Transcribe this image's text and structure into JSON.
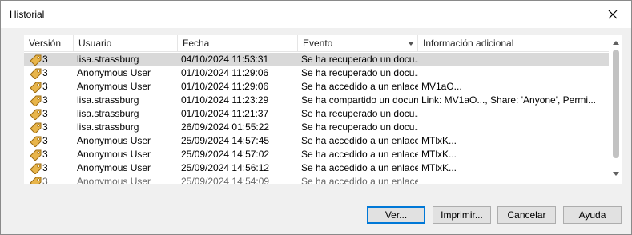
{
  "window": {
    "title": "Historial"
  },
  "columns": [
    "Versión",
    "Usuario",
    "Fecha",
    "Evento",
    "Información adicional"
  ],
  "rows": [
    {
      "version": "3",
      "user": "lisa.strassburg",
      "date": "04/10/2024 11:53:31",
      "event": "Se ha recuperado un docu...",
      "info": "",
      "selected": true
    },
    {
      "version": "3",
      "user": "Anonymous User",
      "date": "01/10/2024 11:29:06",
      "event": "Se ha recuperado un docu...",
      "info": ""
    },
    {
      "version": "3",
      "user": "Anonymous User",
      "date": "01/10/2024 11:29:06",
      "event": "Se ha accedido a un enlace...",
      "info": "MV1aO..."
    },
    {
      "version": "3",
      "user": "lisa.strassburg",
      "date": "01/10/2024 11:23:29",
      "event": "Se ha compartido un docum...",
      "info": "Link: MV1aO..., Share: 'Anyone', Permi..."
    },
    {
      "version": "3",
      "user": "lisa.strassburg",
      "date": "01/10/2024 11:21:37",
      "event": "Se ha recuperado un docu...",
      "info": ""
    },
    {
      "version": "3",
      "user": "lisa.strassburg",
      "date": "26/09/2024 01:55:22",
      "event": "Se ha recuperado un docu...",
      "info": ""
    },
    {
      "version": "3",
      "user": "Anonymous User",
      "date": "25/09/2024 14:57:45",
      "event": "Se ha accedido a un enlace...",
      "info": "MTlxK..."
    },
    {
      "version": "3",
      "user": "Anonymous User",
      "date": "25/09/2024 14:57:02",
      "event": "Se ha accedido a un enlace...",
      "info": "MTlxK..."
    },
    {
      "version": "3",
      "user": "Anonymous User",
      "date": "25/09/2024 14:56:12",
      "event": "Se ha accedido a un enlace...",
      "info": "MTlxK..."
    },
    {
      "version": "3",
      "user": "Anonymous User",
      "date": "25/09/2024 14:54:09",
      "event": "Se ha accedido a un enlace...",
      "info": "",
      "partial": true
    }
  ],
  "buttons": {
    "view": "Ver...",
    "print": "Imprimir...",
    "cancel": "Cancelar",
    "help": "Ayuda"
  },
  "colors": {
    "selected_row": "#d9d9d9",
    "default_button_border": "#0078d7",
    "tag_icon": "#e8b54a"
  }
}
